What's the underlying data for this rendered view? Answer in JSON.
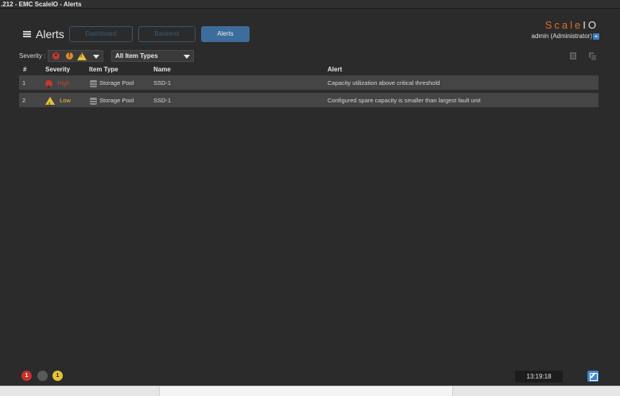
{
  "window": {
    "title": ".212 - EMC ScaleIO - Alerts"
  },
  "header": {
    "page_title": "Alerts",
    "tabs": [
      {
        "label": "Dashboard",
        "active": false
      },
      {
        "label": "Backend",
        "active": false
      },
      {
        "label": "Alerts",
        "active": true
      }
    ],
    "brand_a": "Scale",
    "brand_b": "IO",
    "user": "admin (Administrator)"
  },
  "filters": {
    "severity_label": "Severity :",
    "item_type_value": "All Item Types"
  },
  "table": {
    "columns": [
      "#",
      "Severity",
      "Item Type",
      "Name",
      "Alert"
    ],
    "rows": [
      {
        "num": "1",
        "severity": "High",
        "item_type": "Storage Pool",
        "name": "SSD-1",
        "alert": "Capacity utilization above critical threshold"
      },
      {
        "num": "2",
        "severity": "Low",
        "item_type": "Storage Pool",
        "name": "SSD-1",
        "alert": "Configured spare capacity is smaller than largest fault unit"
      }
    ]
  },
  "footer": {
    "critical_count": "1",
    "medium_count": "",
    "low_count": "1",
    "clock": "13:19:18"
  },
  "colors": {
    "accent": "#3d6d9a",
    "brand_orange": "#d9722a",
    "high": "#c63a2a",
    "low": "#e4c23a"
  }
}
